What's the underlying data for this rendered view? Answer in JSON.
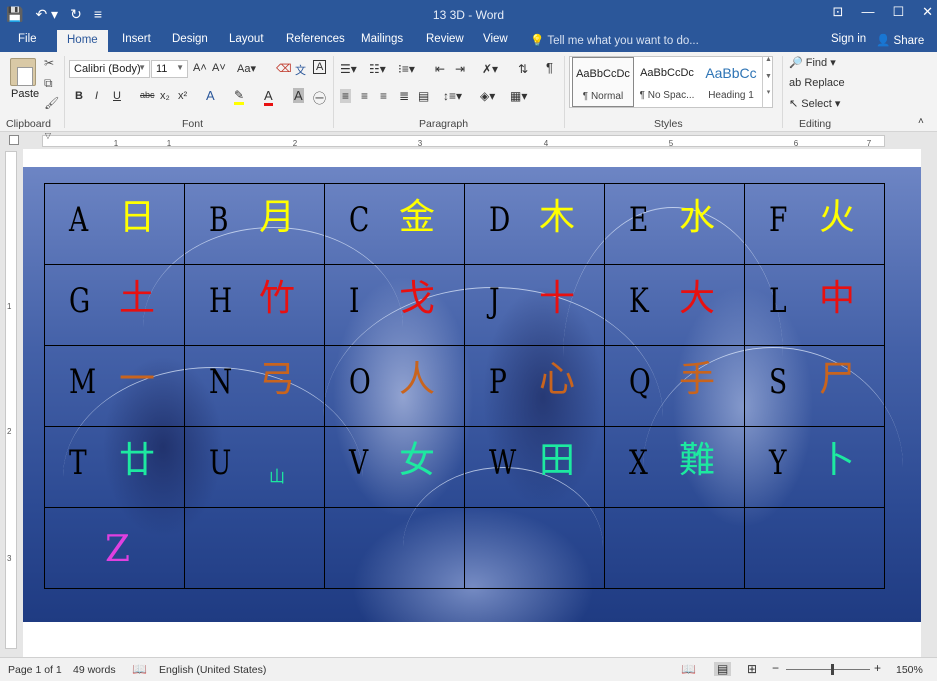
{
  "window": {
    "title": "13 3D - Word",
    "controls": [
      "⊡",
      "—",
      "☐",
      "✕"
    ]
  },
  "qat": [
    "💾",
    "↶ ▾",
    "↻",
    "≡"
  ],
  "tabs": [
    "File",
    "Home",
    "Insert",
    "Design",
    "Layout",
    "References",
    "Mailings",
    "Review",
    "View"
  ],
  "active_tab": "Home",
  "tell_me": "Tell me what you want to do...",
  "signin": "Sign in",
  "share": "Share",
  "ribbon": {
    "clipboard": {
      "paste": "Paste",
      "label": "Clipboard"
    },
    "font": {
      "name": "Calibri (Body)",
      "size": "11",
      "label": "Font",
      "buttons": [
        "B",
        "I",
        "U",
        "abc",
        "x₂",
        "x²"
      ]
    },
    "paragraph": {
      "label": "Paragraph"
    },
    "styles": {
      "label": "Styles",
      "items": [
        {
          "sample": "AaBbCcDc",
          "name": "¶ Normal"
        },
        {
          "sample": "AaBbCcDc",
          "name": "¶ No Spac..."
        },
        {
          "sample": "AaBbCc",
          "name": "Heading 1"
        }
      ]
    },
    "editing": {
      "label": "Editing",
      "find": "Find",
      "replace": "Replace",
      "select": "Select"
    }
  },
  "ruler_ticks": [
    "1",
    "1",
    "2",
    "3",
    "4",
    "5",
    "6",
    "7"
  ],
  "vruler_ticks": [
    "1",
    "2",
    "3"
  ],
  "table": {
    "rows": [
      [
        {
          "letter": "A",
          "hanzi": "日",
          "color": "#ffff00"
        },
        {
          "letter": "B",
          "hanzi": "月",
          "color": "#ffff00"
        },
        {
          "letter": "C",
          "hanzi": "金",
          "color": "#ffff00"
        },
        {
          "letter": "D",
          "hanzi": "木",
          "color": "#ffff00"
        },
        {
          "letter": "E",
          "hanzi": "水",
          "color": "#ffff00"
        },
        {
          "letter": "F",
          "hanzi": "火",
          "color": "#ffff00"
        }
      ],
      [
        {
          "letter": "G",
          "hanzi": "土",
          "color": "#e81010"
        },
        {
          "letter": "H",
          "hanzi": "竹",
          "color": "#e81010"
        },
        {
          "letter": "I",
          "hanzi": "戈",
          "color": "#e81010"
        },
        {
          "letter": "J",
          "hanzi": "十",
          "color": "#e81010"
        },
        {
          "letter": "K",
          "hanzi": "大",
          "color": "#e81010"
        },
        {
          "letter": "L",
          "hanzi": "中",
          "color": "#e81010"
        }
      ],
      [
        {
          "letter": "M",
          "hanzi": "一",
          "color": "#c8641e"
        },
        {
          "letter": "N",
          "hanzi": "弓",
          "color": "#c8641e"
        },
        {
          "letter": "O",
          "hanzi": "人",
          "color": "#c8641e"
        },
        {
          "letter": "P",
          "hanzi": "心",
          "color": "#c8641e"
        },
        {
          "letter": "Q",
          "hanzi": "手",
          "color": "#c8641e"
        },
        {
          "letter": "S",
          "hanzi": "尸",
          "color": "#c8641e"
        }
      ],
      [
        {
          "letter": "T",
          "hanzi": "廿",
          "color": "#1de9a0"
        },
        {
          "letter": "U",
          "hanzi": "山",
          "color": "#1de9a0",
          "small": true
        },
        {
          "letter": "V",
          "hanzi": "女",
          "color": "#1de9a0"
        },
        {
          "letter": "W",
          "hanzi": "田",
          "color": "#1de9a0"
        },
        {
          "letter": "X",
          "hanzi": "難",
          "color": "#1de9a0"
        },
        {
          "letter": "Y",
          "hanzi": "卜",
          "color": "#1de9a0"
        }
      ],
      [
        {
          "letter": "",
          "hanzi": "Z",
          "color": "#e040e0"
        },
        {
          "letter": "",
          "hanzi": ""
        },
        {
          "letter": "",
          "hanzi": ""
        },
        {
          "letter": "",
          "hanzi": ""
        },
        {
          "letter": "",
          "hanzi": ""
        },
        {
          "letter": "",
          "hanzi": ""
        }
      ]
    ]
  },
  "status": {
    "page": "Page 1 of 1",
    "words": "49 words",
    "language": "English (United States)",
    "zoom": "150%"
  }
}
